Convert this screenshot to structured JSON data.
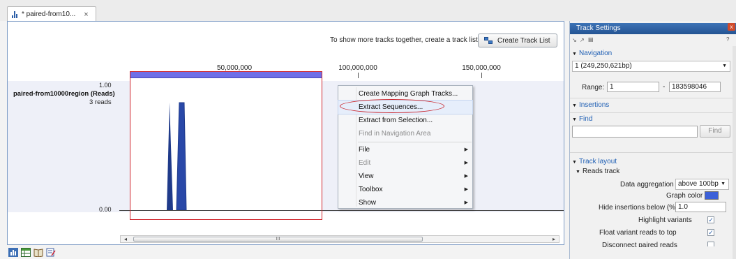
{
  "tab": {
    "title": "* paired-from10...",
    "close": "×"
  },
  "toolbar": {
    "hint": "To show more tracks together, create a track list.",
    "create_track_list": "Create Track List"
  },
  "ruler": {
    "ticks": [
      "50,000,000",
      "100,000,000",
      "150,000,000"
    ]
  },
  "track": {
    "name": "paired-from10000region (Reads)",
    "reads": "3 reads",
    "y_top": "1.00",
    "y_bottom": "0.00"
  },
  "scrollbar": {
    "left": "◂",
    "right": "▸",
    "grip": "III"
  },
  "context_menu": {
    "items": [
      {
        "label": "Create Mapping Graph Tracks...",
        "disabled": false,
        "submenu": false
      },
      {
        "label": "Extract Sequences...",
        "disabled": false,
        "submenu": false
      },
      {
        "label": "Extract from Selection...",
        "disabled": false,
        "submenu": false
      },
      {
        "label": "Find in Navigation Area",
        "disabled": true,
        "submenu": false
      },
      {
        "label": "File",
        "disabled": false,
        "submenu": true
      },
      {
        "label": "Edit",
        "disabled": true,
        "submenu": true
      },
      {
        "label": "View",
        "disabled": false,
        "submenu": true
      },
      {
        "label": "Toolbox",
        "disabled": false,
        "submenu": true
      },
      {
        "label": "Show",
        "disabled": false,
        "submenu": true
      }
    ],
    "submenu_arrow": "▶"
  },
  "side_panel": {
    "title": "Track Settings",
    "close": "x",
    "help": "?",
    "navigation": {
      "heading": "Navigation",
      "chromosome": "1 (249,250,621bp)",
      "range_label": "Range:",
      "range_from": "1",
      "range_dash": "-",
      "range_to": "183598046"
    },
    "insertions": {
      "heading": "Insertions"
    },
    "find": {
      "heading": "Find",
      "button": "Find",
      "value": ""
    },
    "track_layout": {
      "heading": "Track layout",
      "reads_track": "Reads track",
      "data_aggregation_label": "Data aggregation",
      "data_aggregation_value": "above 100bp",
      "graph_color_label": "Graph color",
      "graph_color": "#3c60d8",
      "hide_insertions_label": "Hide insertions below (%)",
      "hide_insertions_value": "1.0",
      "highlight_variants_label": "Highlight variants",
      "highlight_variants": true,
      "float_variant_label": "Float variant reads to top",
      "float_variant": true,
      "disconnect_label": "Disconnect paired reads",
      "disconnect": false
    }
  },
  "colors": {
    "accent": "#245493",
    "selection": "#d0242b",
    "graph": "#1f3a8a",
    "highlight_bar": "#6f6fe8"
  }
}
